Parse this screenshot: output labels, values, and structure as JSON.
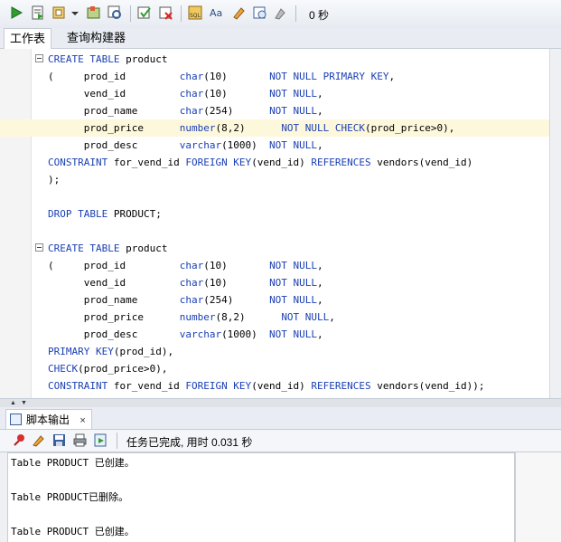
{
  "toolbar": {
    "timer_value": "0",
    "timer_unit": "秒",
    "icons": [
      "run-statement-icon",
      "run-script-icon",
      "explain-plan-icon",
      "autotrace-icon",
      "sql-tuning-icon",
      "commit-icon",
      "rollback-icon",
      "unshared-sql-icon",
      "to-upper-lower-icon",
      "clear-icon",
      "history-icon",
      "format-icon"
    ]
  },
  "tabs": [
    {
      "label": "工作表"
    },
    {
      "label": "查询构建器"
    }
  ],
  "editor": {
    "lines": [
      [
        {
          "t": "CREATE TABLE ",
          "c": "k"
        },
        {
          "t": "product",
          "c": ""
        }
      ],
      [
        {
          "t": "(     prod_id         ",
          "c": ""
        },
        {
          "t": "char",
          "c": "k"
        },
        {
          "t": "(10)       ",
          "c": ""
        },
        {
          "t": "NOT NULL PRIMARY KEY",
          "c": "k"
        },
        {
          "t": ",",
          "c": ""
        }
      ],
      [
        {
          "t": "      vend_id         ",
          "c": ""
        },
        {
          "t": "char",
          "c": "k"
        },
        {
          "t": "(10)       ",
          "c": ""
        },
        {
          "t": "NOT NULL",
          "c": "k"
        },
        {
          "t": ",",
          "c": ""
        }
      ],
      [
        {
          "t": "      prod_name       ",
          "c": ""
        },
        {
          "t": "char",
          "c": "k"
        },
        {
          "t": "(254)      ",
          "c": ""
        },
        {
          "t": "NOT NULL",
          "c": "k"
        },
        {
          "t": ",",
          "c": ""
        }
      ],
      [
        {
          "t": "      prod_price      ",
          "c": ""
        },
        {
          "t": "number",
          "c": "k"
        },
        {
          "t": "(8,2)      ",
          "c": ""
        },
        {
          "t": "NOT NULL CHECK",
          "c": "k"
        },
        {
          "t": "(prod_price>0),",
          "c": ""
        }
      ],
      [
        {
          "t": "      prod_desc       ",
          "c": ""
        },
        {
          "t": "varchar",
          "c": "k"
        },
        {
          "t": "(1000)  ",
          "c": ""
        },
        {
          "t": "NOT NULL",
          "c": "k"
        },
        {
          "t": ",",
          "c": ""
        }
      ],
      [
        {
          "t": "CONSTRAINT",
          "c": "k"
        },
        {
          "t": " for_vend_id ",
          "c": ""
        },
        {
          "t": "FOREIGN KEY",
          "c": "k"
        },
        {
          "t": "(vend_id) ",
          "c": ""
        },
        {
          "t": "REFERENCES",
          "c": "k"
        },
        {
          "t": " vendors(vend_id)",
          "c": ""
        }
      ],
      [
        {
          "t": ");",
          "c": ""
        }
      ],
      [],
      [
        {
          "t": "DROP TABLE ",
          "c": "k"
        },
        {
          "t": "PRODUCT;",
          "c": ""
        }
      ],
      [],
      [
        {
          "t": "CREATE TABLE ",
          "c": "k"
        },
        {
          "t": "product",
          "c": ""
        }
      ],
      [
        {
          "t": "(     prod_id         ",
          "c": ""
        },
        {
          "t": "char",
          "c": "k"
        },
        {
          "t": "(10)       ",
          "c": ""
        },
        {
          "t": "NOT NULL",
          "c": "k"
        },
        {
          "t": ",",
          "c": ""
        }
      ],
      [
        {
          "t": "      vend_id         ",
          "c": ""
        },
        {
          "t": "char",
          "c": "k"
        },
        {
          "t": "(10)       ",
          "c": ""
        },
        {
          "t": "NOT NULL",
          "c": "k"
        },
        {
          "t": ",",
          "c": ""
        }
      ],
      [
        {
          "t": "      prod_name       ",
          "c": ""
        },
        {
          "t": "char",
          "c": "k"
        },
        {
          "t": "(254)      ",
          "c": ""
        },
        {
          "t": "NOT NULL",
          "c": "k"
        },
        {
          "t": ",",
          "c": ""
        }
      ],
      [
        {
          "t": "      prod_price      ",
          "c": ""
        },
        {
          "t": "number",
          "c": "k"
        },
        {
          "t": "(8,2)      ",
          "c": ""
        },
        {
          "t": "NOT NULL",
          "c": "k"
        },
        {
          "t": ",",
          "c": ""
        }
      ],
      [
        {
          "t": "      prod_desc       ",
          "c": ""
        },
        {
          "t": "varchar",
          "c": "k"
        },
        {
          "t": "(1000)  ",
          "c": ""
        },
        {
          "t": "NOT NULL",
          "c": "k"
        },
        {
          "t": ",",
          "c": ""
        }
      ],
      [
        {
          "t": "PRIMARY KEY",
          "c": "k"
        },
        {
          "t": "(prod_id),",
          "c": ""
        }
      ],
      [
        {
          "t": "CHECK",
          "c": "k"
        },
        {
          "t": "(prod_price>0),",
          "c": ""
        }
      ],
      [
        {
          "t": "CONSTRAINT",
          "c": "k"
        },
        {
          "t": " for_vend_id ",
          "c": ""
        },
        {
          "t": "FOREIGN KEY",
          "c": "k"
        },
        {
          "t": "(vend_id) ",
          "c": ""
        },
        {
          "t": "REFERENCES",
          "c": "k"
        },
        {
          "t": " vendors(vend_id));",
          "c": ""
        }
      ]
    ],
    "highlighted_line": 4
  },
  "output_panel": {
    "tab_label": "脚本输出",
    "close": "×",
    "status": "任务已完成, 用时 0.031 秒",
    "lines": [
      "Table PRODUCT 已创建。",
      "",
      "Table PRODUCT已删除。",
      "",
      "Table PRODUCT 已创建。"
    ]
  }
}
